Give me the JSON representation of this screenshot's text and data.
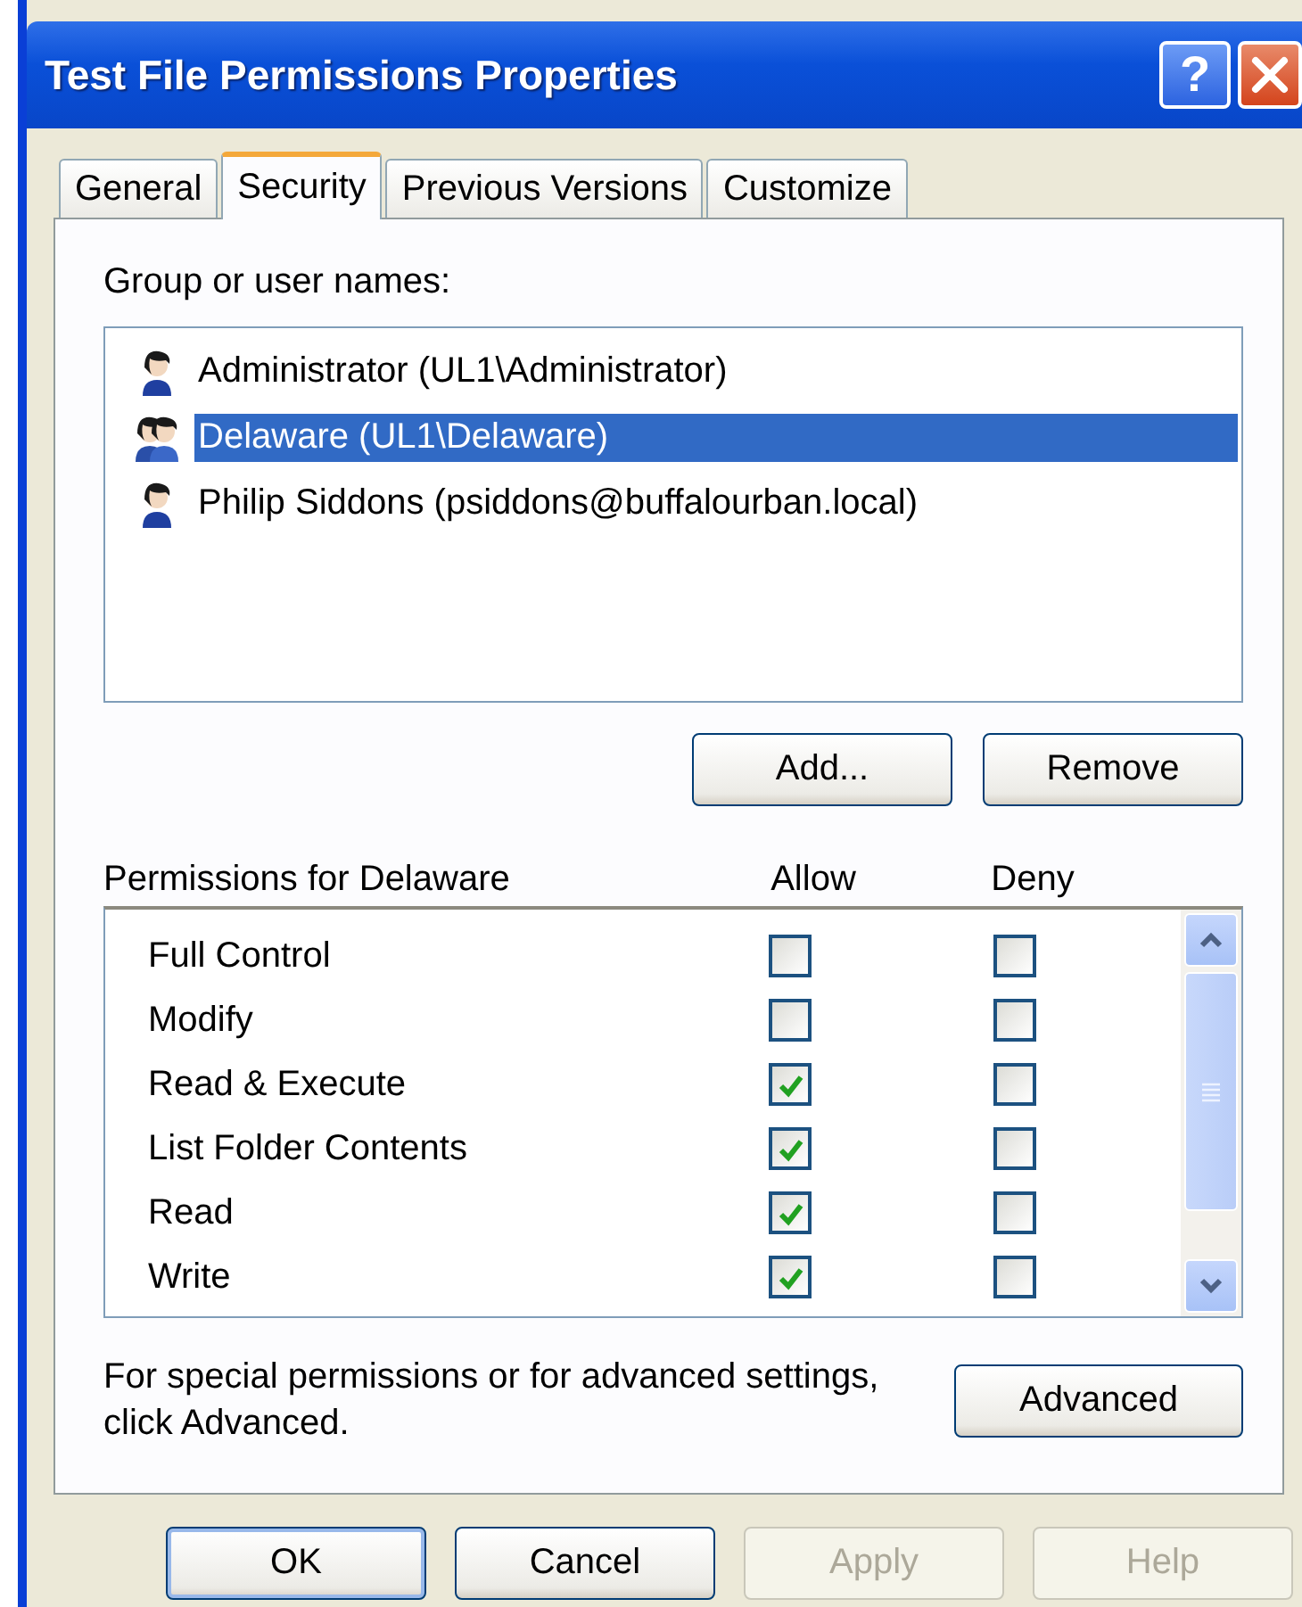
{
  "window": {
    "title": "Test File Permissions Properties",
    "help_button": "?"
  },
  "tabs": [
    {
      "label": "General",
      "selected": false
    },
    {
      "label": "Security",
      "selected": true
    },
    {
      "label": "Previous Versions",
      "selected": false
    },
    {
      "label": "Customize",
      "selected": false
    }
  ],
  "group_label": "Group or user names:",
  "users": [
    {
      "name": "Administrator (UL1\\Administrator)",
      "kind": "user",
      "selected": false
    },
    {
      "name": "Delaware (UL1\\Delaware)",
      "kind": "group",
      "selected": true
    },
    {
      "name": "Philip Siddons (psiddons@buffalourban.local)",
      "kind": "user",
      "selected": false
    }
  ],
  "user_buttons": [
    "Add...",
    "Remove"
  ],
  "permissions": {
    "label": "Permissions for Delaware",
    "columns": [
      "Allow",
      "Deny"
    ],
    "rows": [
      {
        "name": "Full Control",
        "allow": false,
        "deny": false
      },
      {
        "name": "Modify",
        "allow": false,
        "deny": false
      },
      {
        "name": "Read & Execute",
        "allow": true,
        "deny": false
      },
      {
        "name": "List Folder Contents",
        "allow": true,
        "deny": false
      },
      {
        "name": "Read",
        "allow": true,
        "deny": false
      },
      {
        "name": "Write",
        "allow": true,
        "deny": false
      }
    ]
  },
  "advanced": {
    "text": "For special permissions or for advanced settings, click Advanced.",
    "button": "Advanced"
  },
  "dialog_buttons": [
    {
      "label": "OK",
      "disabled": false,
      "default": true
    },
    {
      "label": "Cancel",
      "disabled": false,
      "default": false
    },
    {
      "label": "Apply",
      "disabled": true,
      "default": false
    },
    {
      "label": "Help",
      "disabled": true,
      "default": false
    }
  ]
}
